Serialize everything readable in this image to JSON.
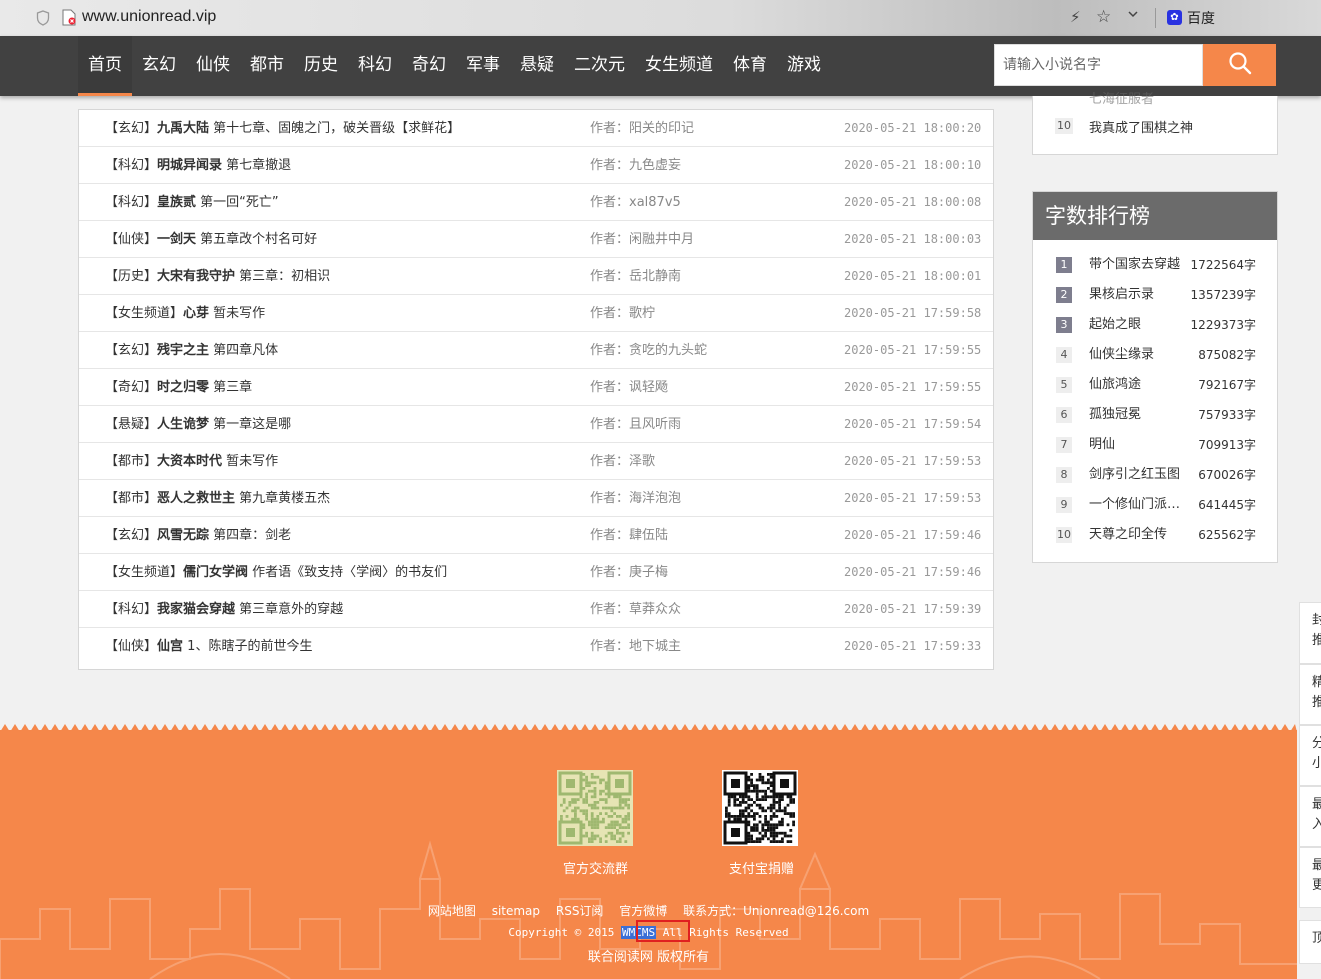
{
  "browser": {
    "url": "www.unionread.vip",
    "search_engine": "百度",
    "icons": [
      "shield-icon",
      "doc-warning-icon",
      "bolt-icon",
      "star-icon",
      "chevron-down-icon",
      "baidu-paw-icon"
    ]
  },
  "nav": {
    "items": [
      {
        "label": "首页",
        "active": true
      },
      {
        "label": "玄幻"
      },
      {
        "label": "仙侠"
      },
      {
        "label": "都市"
      },
      {
        "label": "历史"
      },
      {
        "label": "科幻"
      },
      {
        "label": "奇幻"
      },
      {
        "label": "军事"
      },
      {
        "label": "悬疑"
      },
      {
        "label": "二次元"
      },
      {
        "label": "女生频道"
      },
      {
        "label": "体育"
      },
      {
        "label": "游戏"
      }
    ],
    "search_placeholder": "请输入小说名字",
    "search_icon": "search-icon"
  },
  "updates": [
    {
      "cat": "【玄幻】",
      "title": "九禹大陆",
      "chapter": "第十七章、固魄之门，破关晋级【求鲜花】",
      "author": "作者：阳关的印记",
      "time": "2020-05-21 18:00:20"
    },
    {
      "cat": "【科幻】",
      "title": "明城异闻录",
      "chapter": "第七章撤退",
      "author": "作者：九色虚妄",
      "time": "2020-05-21 18:00:10"
    },
    {
      "cat": "【科幻】",
      "title": "皇族贰",
      "chapter": "第一回“死亡”",
      "author": "作者：xal87v5",
      "time": "2020-05-21 18:00:08"
    },
    {
      "cat": "【仙侠】",
      "title": "一剑天",
      "chapter": "第五章改个村名可好",
      "author": "作者：闲融井中月",
      "time": "2020-05-21 18:00:03"
    },
    {
      "cat": "【历史】",
      "title": "大宋有我守护",
      "chapter": "第三章：初相识",
      "author": "作者：岳北静南",
      "time": "2020-05-21 18:00:01"
    },
    {
      "cat": "【女生频道】",
      "title": "心芽",
      "chapter": "暂未写作",
      "author": "作者：歌柠",
      "time": "2020-05-21 17:59:58"
    },
    {
      "cat": "【玄幻】",
      "title": "残宇之主",
      "chapter": "第四章凡体",
      "author": "作者：贪吃的九头蛇",
      "time": "2020-05-21 17:59:55"
    },
    {
      "cat": "【奇幻】",
      "title": "时之归零",
      "chapter": "第三章",
      "author": "作者：讽轻飏",
      "time": "2020-05-21 17:59:55"
    },
    {
      "cat": "【悬疑】",
      "title": "人生诡梦",
      "chapter": "第一章这是哪",
      "author": "作者：且风听雨",
      "time": "2020-05-21 17:59:54"
    },
    {
      "cat": "【都市】",
      "title": "大资本时代",
      "chapter": "暂未写作",
      "author": "作者：泽歌",
      "time": "2020-05-21 17:59:53"
    },
    {
      "cat": "【都市】",
      "title": "恶人之救世主",
      "chapter": "第九章黄楼五杰",
      "author": "作者：海洋泡泡",
      "time": "2020-05-21 17:59:53"
    },
    {
      "cat": "【玄幻】",
      "title": "风雪无踪",
      "chapter": "第四章：剑老",
      "author": "作者：肆伍陆",
      "time": "2020-05-21 17:59:46"
    },
    {
      "cat": "【女生频道】",
      "title": "儒门女学阀",
      "chapter": "作者语《致支持〈学阀〉的书友们",
      "author": "作者：庚子梅",
      "time": "2020-05-21 17:59:46"
    },
    {
      "cat": "【科幻】",
      "title": "我家猫会穿越",
      "chapter": "第三章意外的穿越",
      "author": "作者：草莽众众",
      "time": "2020-05-21 17:59:39"
    },
    {
      "cat": "【仙侠】",
      "title": "仙宫",
      "chapter": "1、陈瞎子的前世今生",
      "author": "作者：地下城主",
      "time": "2020-05-21 17:59:33"
    }
  ],
  "panel_top": {
    "faded_item": "七海征服者",
    "item_num": "10",
    "item_name": "我真成了围棋之神"
  },
  "word_rank": {
    "title": "字数排行榜",
    "items": [
      {
        "n": "1",
        "title": "带个国家去穿越",
        "count": "1722564字"
      },
      {
        "n": "2",
        "title": "果核启示录",
        "count": "1357239字"
      },
      {
        "n": "3",
        "title": "起始之眼",
        "count": "1229373字"
      },
      {
        "n": "4",
        "title": "仙侠尘缘录",
        "count": "875082字"
      },
      {
        "n": "5",
        "title": "仙旅鸿途",
        "count": "792167字"
      },
      {
        "n": "6",
        "title": "孤独冠冕",
        "count": "757933字"
      },
      {
        "n": "7",
        "title": "明仙",
        "count": "709913字"
      },
      {
        "n": "8",
        "title": "剑序引之红玉图",
        "count": "670026字"
      },
      {
        "n": "9",
        "title": "一个修仙门派的…",
        "count": "641445字"
      },
      {
        "n": "10",
        "title": "天尊之印全传",
        "count": "625562字"
      }
    ]
  },
  "side_tabs": [
    "封推",
    "精推",
    "分小",
    "最入",
    "最更",
    "顶"
  ],
  "footer": {
    "qr1_label": "官方交流群",
    "qr2_label": "支付宝捐赠",
    "links": [
      "网站地图",
      "sitemap",
      "RSS订阅",
      "官方微博",
      "联系方式：Unionread@126.com"
    ],
    "copyright_prefix": "Copyright © 2015 ",
    "copyright_highlight": "WMCMS",
    "copyright_suffix": " All Rights Reserved",
    "rights": "联合阅读网 版权所有"
  }
}
